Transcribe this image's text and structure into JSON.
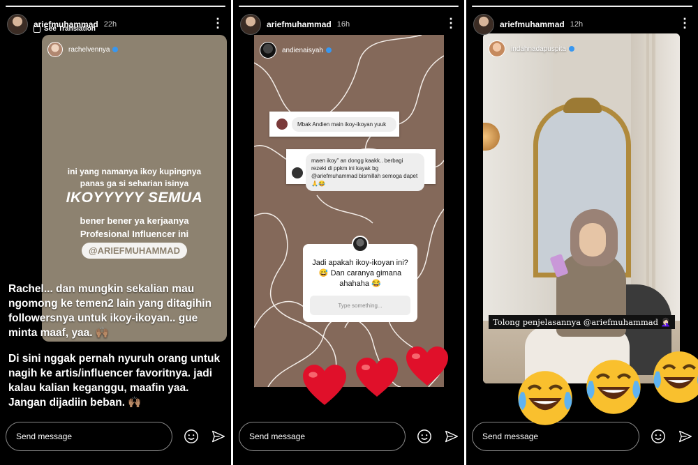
{
  "panels": [
    {
      "username": "ariefmuhammad",
      "time": "22h",
      "see_translation": "See Translation",
      "reshared_user": "rachelvennya",
      "story_lines": {
        "line1": "ini yang namanya ikoy kupingnya",
        "line2": "panas ga si seharian isinya",
        "big": "IKOYYYYY SEMUA",
        "line3": "bener bener ya kerjaanya",
        "line4": "Profesional Influencer ini",
        "mention": "@ARIEFMUHAMMAD"
      },
      "caption_1": "Rachel... dan mungkin sekalian mau ngomong ke temen2 lain yang ditagihin followersnya untuk ikoy-ikoyan.. gue minta maaf, yaa. 🙌🏽",
      "caption_2": "Di sini nggak pernah nyuruh orang untuk nagih ke artis/influencer favoritnya. jadi kalau kalian keganggu, maafin yaa. Jangan dijadiin beban. 🙌🏽",
      "send_message": "Send message",
      "progress": 1.0
    },
    {
      "username": "ariefmuhammad",
      "time": "16h",
      "reshared_user": "andienaisyah",
      "question_1": "Mbak Andien main ikoy-ikoyan yuuk",
      "question_2": "maen ikoy\" an dongg kaakk.. berbagi rezeki di ppkm ini kayak bg @ariefmuhammad bismillah semoga dapet 🙏😂",
      "question_box": "Jadi apakah ikoy-ikoyan ini? 😅 Dan caranya gimana ahahaha 😂",
      "input_placeholder": "Type something...",
      "send_message": "Send message",
      "progress": 1.0
    },
    {
      "username": "ariefmuhammad",
      "time": "12h",
      "reshared_user": "indahnadapuspita",
      "caption": "Tolong penjelasannya @ariefmuhammad 🤦🏻‍♀️",
      "send_message": "Send message",
      "progress": 1.0
    }
  ],
  "icons": {
    "more": "kebab-icon",
    "sticker": "sticker-icon",
    "send": "paper-plane-icon",
    "heart": "red-heart",
    "emoji": "tears-of-joy"
  },
  "colors": {
    "story1_bg": "#8d8270",
    "story2_bg": "#84695a",
    "verified": "#3897f0",
    "heart": "#e0102a",
    "emoji": "#f9c02e"
  }
}
